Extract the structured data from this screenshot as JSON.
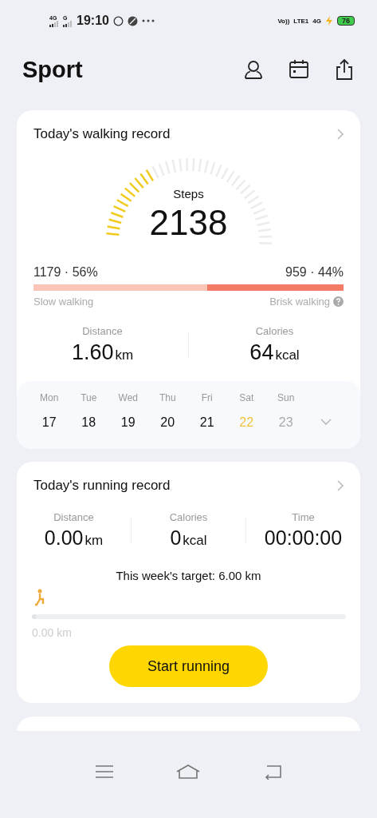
{
  "status_bar": {
    "left_signals": [
      "4G",
      "G"
    ],
    "time": "19:10",
    "right_signals": [
      "Vo))",
      "LTE1",
      "4G"
    ],
    "battery": "76"
  },
  "header": {
    "title": "Sport"
  },
  "walking": {
    "title": "Today's walking record",
    "gauge": {
      "label": "Steps",
      "value": "2138",
      "level": 0.3
    },
    "split": {
      "left_reading": "1179 · 56%",
      "right_reading": "959 · 44%",
      "level": 0.56,
      "left_label": "Slow walking",
      "right_label": "Brisk walking"
    },
    "stats": [
      {
        "label": "Distance",
        "value": "1.60",
        "unit": "km"
      },
      {
        "label": "Calories",
        "value": "64",
        "unit": "kcal"
      }
    ],
    "week": [
      {
        "day": "Mon",
        "date": "17",
        "selected": false,
        "disabled": false
      },
      {
        "day": "Tue",
        "date": "18",
        "selected": false,
        "disabled": false
      },
      {
        "day": "Wed",
        "date": "19",
        "selected": false,
        "disabled": false
      },
      {
        "day": "Thu",
        "date": "20",
        "selected": false,
        "disabled": false
      },
      {
        "day": "Fri",
        "date": "21",
        "selected": false,
        "disabled": false
      },
      {
        "day": "Sat",
        "date": "22",
        "selected": true,
        "disabled": false
      },
      {
        "day": "Sun",
        "date": "23",
        "selected": false,
        "disabled": true
      }
    ]
  },
  "running": {
    "title": "Today's running record",
    "stats": [
      {
        "label": "Distance",
        "value": "0.00",
        "unit": "km"
      },
      {
        "label": "Calories",
        "value": "0",
        "unit": "kcal"
      },
      {
        "label": "Time",
        "value": "00:00:00"
      }
    ],
    "target": "This week's target: 6.00 km",
    "level": 0,
    "progress_reading": "0.00 km",
    "button": "Start running"
  }
}
